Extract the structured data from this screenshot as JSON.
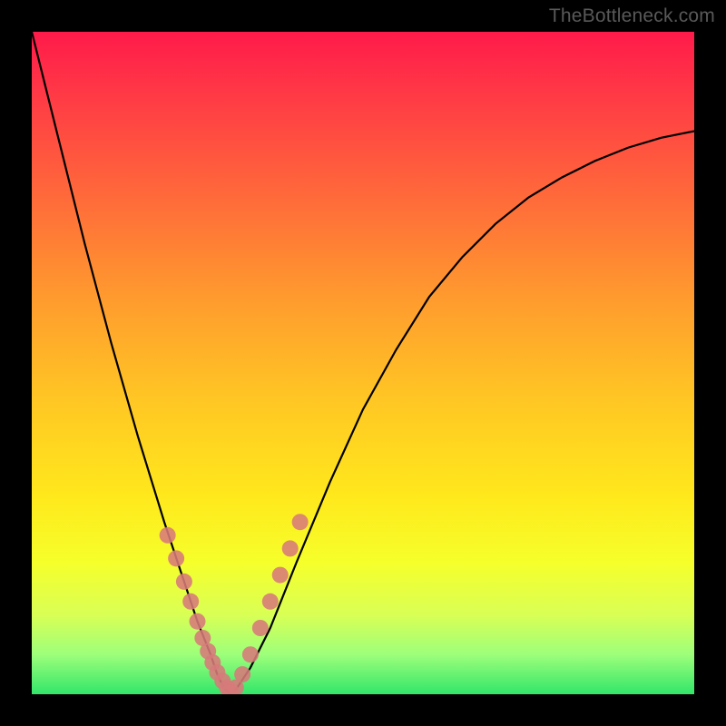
{
  "watermark": "TheBottleneck.com",
  "chart_data": {
    "type": "line",
    "title": "",
    "xlabel": "",
    "ylabel": "",
    "xlim": [
      0,
      100
    ],
    "ylim": [
      0,
      100
    ],
    "grid": false,
    "legend": false,
    "series": [
      {
        "name": "bottleneck-curve",
        "color": "#000000",
        "x": [
          0,
          4,
          8,
          12,
          16,
          20,
          23,
          25,
          27,
          28,
          29,
          30,
          31,
          33,
          36,
          40,
          45,
          50,
          55,
          60,
          65,
          70,
          75,
          80,
          85,
          90,
          95,
          100
        ],
        "y": [
          100,
          84,
          68,
          53,
          39,
          26,
          17,
          11,
          6,
          3,
          1,
          0,
          1,
          4,
          10,
          20,
          32,
          43,
          52,
          60,
          66,
          71,
          75,
          78,
          80.5,
          82.5,
          84,
          85
        ]
      }
    ],
    "markers": {
      "name": "highlighted-points",
      "color": "#d77a7a",
      "radius_px": 9,
      "x": [
        20.5,
        21.8,
        23.0,
        24.0,
        25.0,
        25.8,
        26.6,
        27.3,
        28.0,
        28.8,
        29.5,
        30.0,
        30.8,
        31.8,
        33.0,
        34.5,
        36.0,
        37.5,
        39.0,
        40.5
      ],
      "y": [
        24.0,
        20.5,
        17.0,
        14.0,
        11.0,
        8.5,
        6.5,
        4.8,
        3.3,
        2.0,
        1.0,
        0.5,
        1.0,
        3.0,
        6.0,
        10.0,
        14.0,
        18.0,
        22.0,
        26.0
      ]
    },
    "background_gradient": {
      "top": "#ff1a4a",
      "bottom": "#32e66a"
    }
  }
}
